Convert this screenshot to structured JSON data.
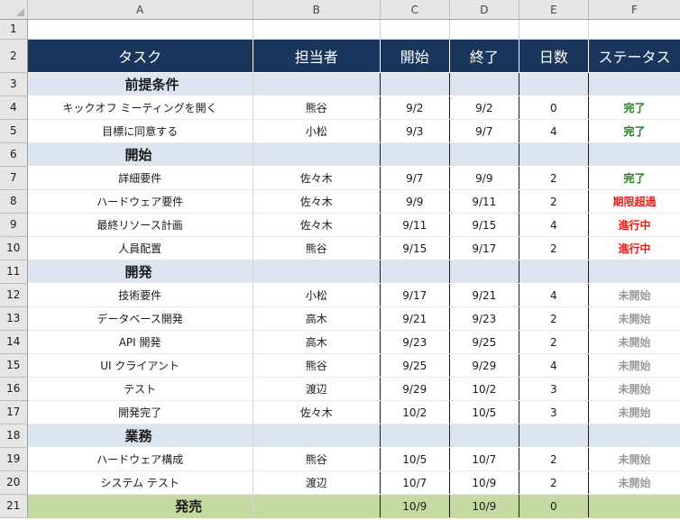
{
  "columns": [
    "A",
    "B",
    "C",
    "D",
    "E",
    "F"
  ],
  "header": {
    "row": "2",
    "task": "タスク",
    "owner": "担当者",
    "start": "開始",
    "end": "終了",
    "days": "日数",
    "status": "ステータス"
  },
  "row1": "1",
  "rows": [
    {
      "n": "3",
      "type": "section",
      "task": "前提条件"
    },
    {
      "n": "4",
      "type": "task",
      "task": "キックオフ ミーティングを開く",
      "owner": "熊谷",
      "start": "9/2",
      "end": "9/2",
      "days": "0",
      "status": "完了",
      "status_kind": "done"
    },
    {
      "n": "5",
      "type": "task",
      "task": "目標に同意する",
      "owner": "小松",
      "start": "9/3",
      "end": "9/7",
      "days": "4",
      "status": "完了",
      "status_kind": "done"
    },
    {
      "n": "6",
      "type": "section",
      "task": "開始"
    },
    {
      "n": "7",
      "type": "task",
      "task": "詳細要件",
      "owner": "佐々木",
      "start": "9/7",
      "end": "9/9",
      "days": "2",
      "status": "完了",
      "status_kind": "done"
    },
    {
      "n": "8",
      "type": "task",
      "task": "ハードウェア要件",
      "owner": "佐々木",
      "start": "9/9",
      "end": "9/11",
      "days": "2",
      "status": "期限超過",
      "status_kind": "late"
    },
    {
      "n": "9",
      "type": "task",
      "task": "最終リソース計画",
      "owner": "佐々木",
      "start": "9/11",
      "end": "9/15",
      "days": "4",
      "status": "進行中",
      "status_kind": "prog"
    },
    {
      "n": "10",
      "type": "task",
      "task": "人員配置",
      "owner": "熊谷",
      "start": "9/15",
      "end": "9/17",
      "days": "2",
      "status": "進行中",
      "status_kind": "prog"
    },
    {
      "n": "11",
      "type": "section",
      "task": "開発"
    },
    {
      "n": "12",
      "type": "task",
      "task": "技術要件",
      "owner": "小松",
      "start": "9/17",
      "end": "9/21",
      "days": "4",
      "status": "未開始",
      "status_kind": "todo"
    },
    {
      "n": "13",
      "type": "task",
      "task": "データベース開発",
      "owner": "高木",
      "start": "9/21",
      "end": "9/23",
      "days": "2",
      "status": "未開始",
      "status_kind": "todo"
    },
    {
      "n": "14",
      "type": "task",
      "task": "API 開発",
      "owner": "高木",
      "start": "9/23",
      "end": "9/25",
      "days": "2",
      "status": "未開始",
      "status_kind": "todo"
    },
    {
      "n": "15",
      "type": "task",
      "task": "UI クライアント",
      "owner": "熊谷",
      "start": "9/25",
      "end": "9/29",
      "days": "4",
      "status": "未開始",
      "status_kind": "todo"
    },
    {
      "n": "16",
      "type": "task",
      "task": "テスト",
      "owner": "渡辺",
      "start": "9/29",
      "end": "10/2",
      "days": "3",
      "status": "未開始",
      "status_kind": "todo"
    },
    {
      "n": "17",
      "type": "task",
      "task": "開発完了",
      "owner": "佐々木",
      "start": "10/2",
      "end": "10/5",
      "days": "3",
      "status": "未開始",
      "status_kind": "todo"
    },
    {
      "n": "18",
      "type": "section",
      "task": "業務"
    },
    {
      "n": "19",
      "type": "task",
      "task": "ハードウェア構成",
      "owner": "熊谷",
      "start": "10/5",
      "end": "10/7",
      "days": "2",
      "status": "未開始",
      "status_kind": "todo"
    },
    {
      "n": "20",
      "type": "task",
      "task": "システム テスト",
      "owner": "渡辺",
      "start": "10/7",
      "end": "10/9",
      "days": "2",
      "status": "未開始",
      "status_kind": "todo"
    },
    {
      "n": "21",
      "type": "final",
      "task": "発売",
      "owner": "",
      "start": "10/9",
      "end": "10/9",
      "days": "0",
      "status": ""
    }
  ],
  "colors": {
    "header_bg": "#1b365d",
    "section_bg": "#dce6f0",
    "final_bg": "#c5d9a2",
    "status_done": "#1e7b1e",
    "status_late": "#e0201b",
    "status_progress": "#e0201b",
    "status_todo": "#9a9a9a"
  }
}
